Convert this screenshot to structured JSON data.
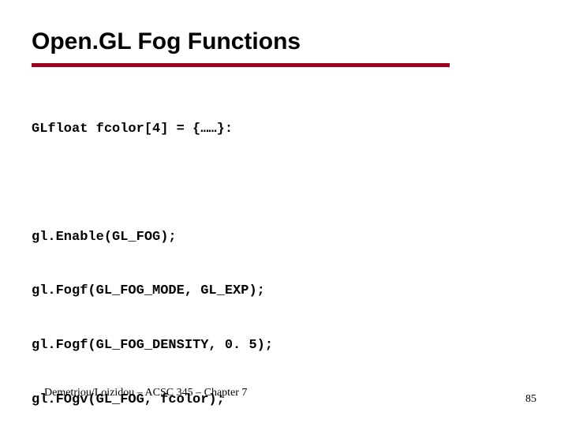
{
  "title": "Open.GL Fog Functions",
  "code": {
    "decl": "GLfloat fcolor[4] = {……}:",
    "l1": "gl.Enable(GL_FOG);",
    "l2": "gl.Fogf(GL_FOG_MODE, GL_EXP);",
    "l3": "gl.Fogf(GL_FOG_DENSITY, 0. 5);",
    "l4": "gl.FOgv(GL_FOG, fcolor);"
  },
  "footer": {
    "left": "Demetriou/Loizidou – ACSC 345 – Chapter 7",
    "page": "85"
  }
}
